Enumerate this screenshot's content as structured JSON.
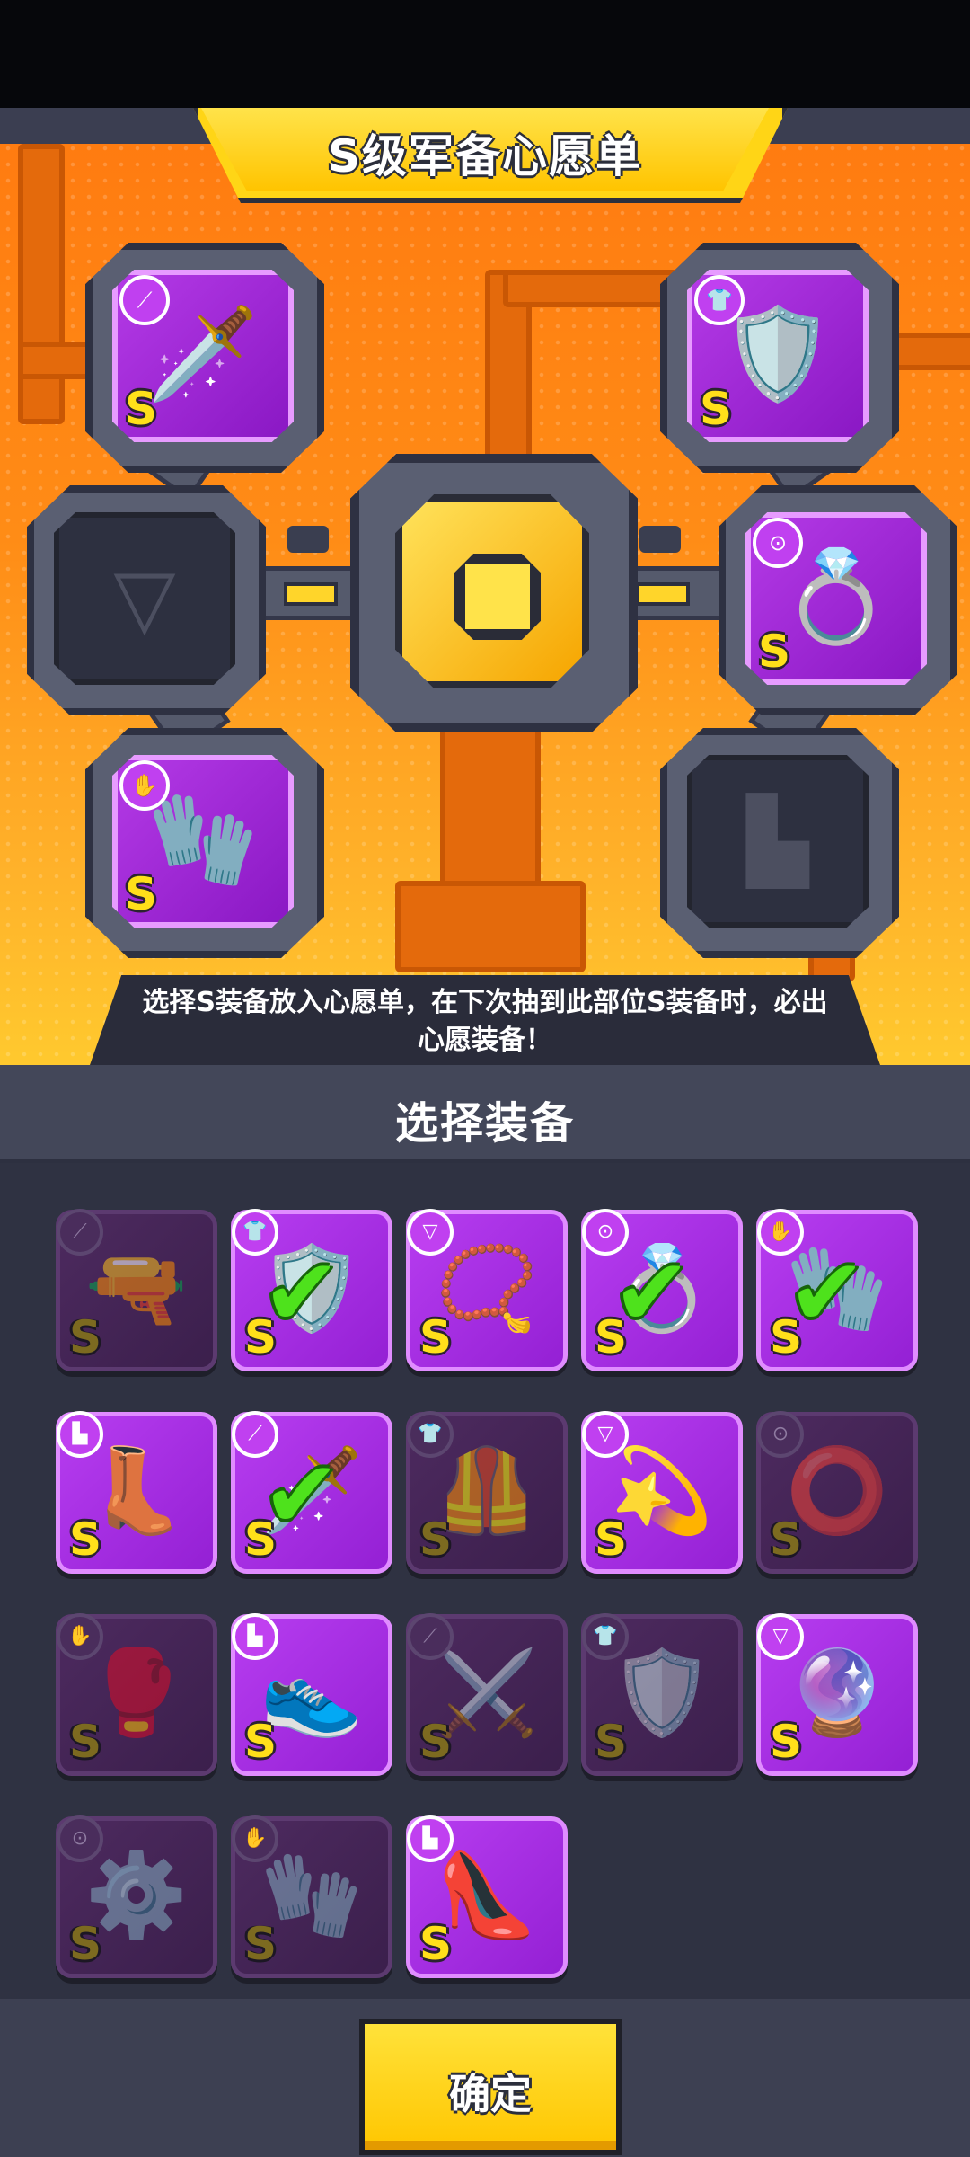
{
  "wishlist": {
    "title": "S级军备心愿单",
    "hint": "选择S装备放入心愿单，在下次抽到此部位S装备时，必出心愿装备！",
    "slots": [
      {
        "slot": "weapon",
        "filled": true,
        "icon": "sword-icon",
        "art": "🗡️",
        "grade": "S"
      },
      {
        "slot": "armor",
        "filled": true,
        "icon": "armor-icon",
        "art": "🛡️",
        "grade": "S"
      },
      {
        "slot": "necklace",
        "filled": false,
        "icon": "necklace-icon",
        "art": "",
        "grade": ""
      },
      {
        "slot": "belt",
        "filled": true,
        "icon": "belt-icon",
        "art": "💍",
        "grade": "S"
      },
      {
        "slot": "gloves",
        "filled": true,
        "icon": "gauntlet-icon",
        "art": "🧤",
        "grade": "S"
      },
      {
        "slot": "boots",
        "filled": false,
        "icon": "boot-icon",
        "art": "",
        "grade": ""
      }
    ]
  },
  "selection": {
    "title": "选择装备",
    "items": [
      {
        "icon": "weapon-icon",
        "art": "🔫",
        "grade": "S",
        "available": false,
        "checked": false
      },
      {
        "icon": "armor-icon",
        "art": "🛡️",
        "grade": "S",
        "available": true,
        "checked": true
      },
      {
        "icon": "necklace-icon",
        "art": "📿",
        "grade": "S",
        "available": true,
        "checked": false
      },
      {
        "icon": "belt-icon",
        "art": "💍",
        "grade": "S",
        "available": true,
        "checked": true
      },
      {
        "icon": "gauntlet-icon",
        "art": "🧤",
        "grade": "S",
        "available": true,
        "checked": true
      },
      {
        "icon": "boot-icon",
        "art": "👢",
        "grade": "S",
        "available": true,
        "checked": false
      },
      {
        "icon": "weapon-icon",
        "art": "🗡️",
        "grade": "S",
        "available": true,
        "checked": true
      },
      {
        "icon": "armor-icon",
        "art": "🦺",
        "grade": "S",
        "available": false,
        "checked": false
      },
      {
        "icon": "necklace-icon",
        "art": "💫",
        "grade": "S",
        "available": true,
        "checked": false
      },
      {
        "icon": "belt-icon",
        "art": "⭕",
        "grade": "S",
        "available": false,
        "checked": false
      },
      {
        "icon": "gauntlet-icon",
        "art": "🥊",
        "grade": "S",
        "available": false,
        "checked": false
      },
      {
        "icon": "boot-icon",
        "art": "👟",
        "grade": "S",
        "available": true,
        "checked": false
      },
      {
        "icon": "weapon-icon",
        "art": "⚔️",
        "grade": "S",
        "available": false,
        "checked": false
      },
      {
        "icon": "armor-icon",
        "art": "🛡️",
        "grade": "S",
        "available": false,
        "checked": false
      },
      {
        "icon": "necklace-icon",
        "art": "🔮",
        "grade": "S",
        "available": true,
        "checked": false
      },
      {
        "icon": "belt-icon",
        "art": "⚙️",
        "grade": "S",
        "available": false,
        "checked": false
      },
      {
        "icon": "gauntlet-icon",
        "art": "🧤",
        "grade": "S",
        "available": false,
        "checked": false
      },
      {
        "icon": "boot-icon",
        "art": "👠",
        "grade": "S",
        "available": true,
        "checked": false
      }
    ]
  },
  "confirm": {
    "label": "确定"
  },
  "colors": {
    "accent": "#ffd516",
    "item_purple": "#b73df0",
    "check_green": "#4ee21c",
    "panel": "#2f3242"
  }
}
